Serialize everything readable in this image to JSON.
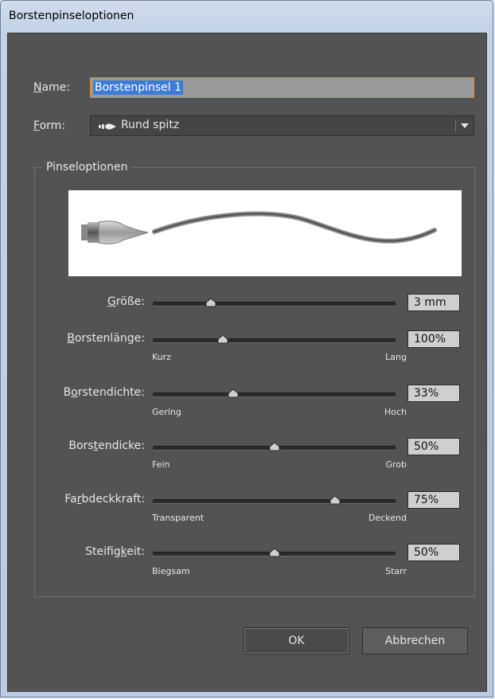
{
  "window": {
    "title": "Borstenpinseloptionen"
  },
  "name_field": {
    "label": "Name:",
    "label_accel": "N",
    "label_rest": "ame:",
    "value": "Borstenpinsel 1"
  },
  "form_field": {
    "label_accel": "F",
    "label_rest": "orm:",
    "value": "Rund spitz",
    "icon": "round-point-brush-icon"
  },
  "group": {
    "legend": "Pinseloptionen"
  },
  "sliders": [
    {
      "label_pre": "",
      "label_accel": "G",
      "label_post": "röße:",
      "value_text": "3 mm",
      "position": 0.24,
      "min_label": "",
      "max_label": ""
    },
    {
      "label_pre": "",
      "label_accel": "B",
      "label_post": "orstenlänge:",
      "value_text": "100%",
      "position": 0.29,
      "min_label": "Kurz",
      "max_label": "Lang"
    },
    {
      "label_pre": "B",
      "label_accel": "o",
      "label_post": "rstendichte:",
      "value_text": "33%",
      "position": 0.33,
      "min_label": "Gering",
      "max_label": "Hoch"
    },
    {
      "label_pre": "Bors",
      "label_accel": "t",
      "label_post": "endicke:",
      "value_text": "50%",
      "position": 0.5,
      "min_label": "Fein",
      "max_label": "Grob"
    },
    {
      "label_pre": "Fa",
      "label_accel": "r",
      "label_post": "bdeckkraft:",
      "value_text": "75%",
      "position": 0.75,
      "min_label": "Transparent",
      "max_label": "Deckend"
    },
    {
      "label_pre": "Steifig",
      "label_accel": "k",
      "label_post": "eit:",
      "value_text": "50%",
      "position": 0.5,
      "min_label": "Biegsam",
      "max_label": "Starr"
    }
  ],
  "buttons": {
    "ok": "OK",
    "cancel": "Abbrechen"
  },
  "colors": {
    "dialog_bg": "#535353",
    "accent_focus": "#e58d1f",
    "selection": "#3e7bd6",
    "value_box": "#cfcfcf"
  }
}
